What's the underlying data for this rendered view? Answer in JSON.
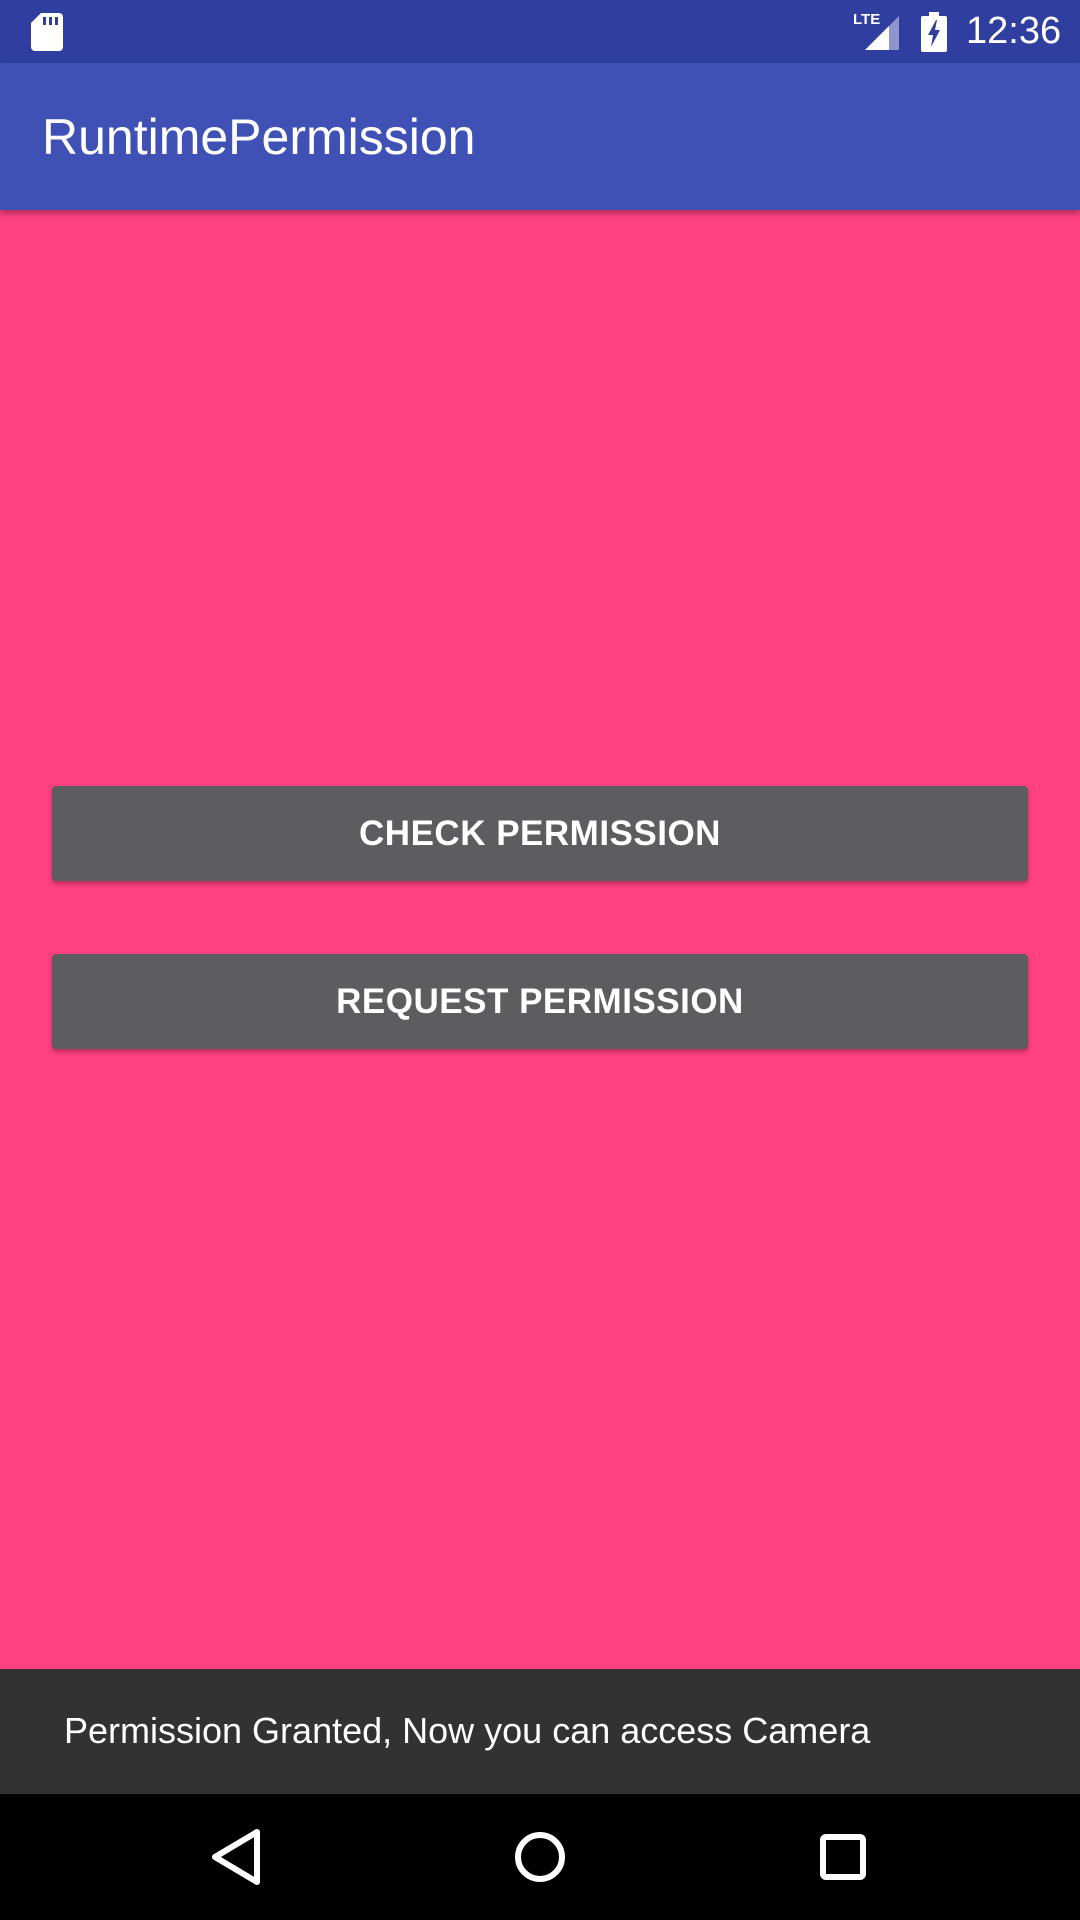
{
  "status_bar": {
    "time": "12:36",
    "network_label": "LTE",
    "icons": [
      "sd-card-icon",
      "lte-signal-icon",
      "battery-charging-icon"
    ]
  },
  "app_bar": {
    "title": "RuntimePermission",
    "color": "#3f51b5"
  },
  "content": {
    "background_color": "#ff4081",
    "check_button_label": "CHECK PERMISSION",
    "request_button_label": "REQUEST PERMISSION"
  },
  "snackbar": {
    "message": "Permission Granted, Now you can access Camera"
  },
  "nav_bar": {
    "icons": [
      "back-icon",
      "home-icon",
      "recents-icon"
    ]
  },
  "colors": {
    "status_bar": "#303f9f",
    "button": "#5d5d5f",
    "snackbar": "#323232"
  }
}
